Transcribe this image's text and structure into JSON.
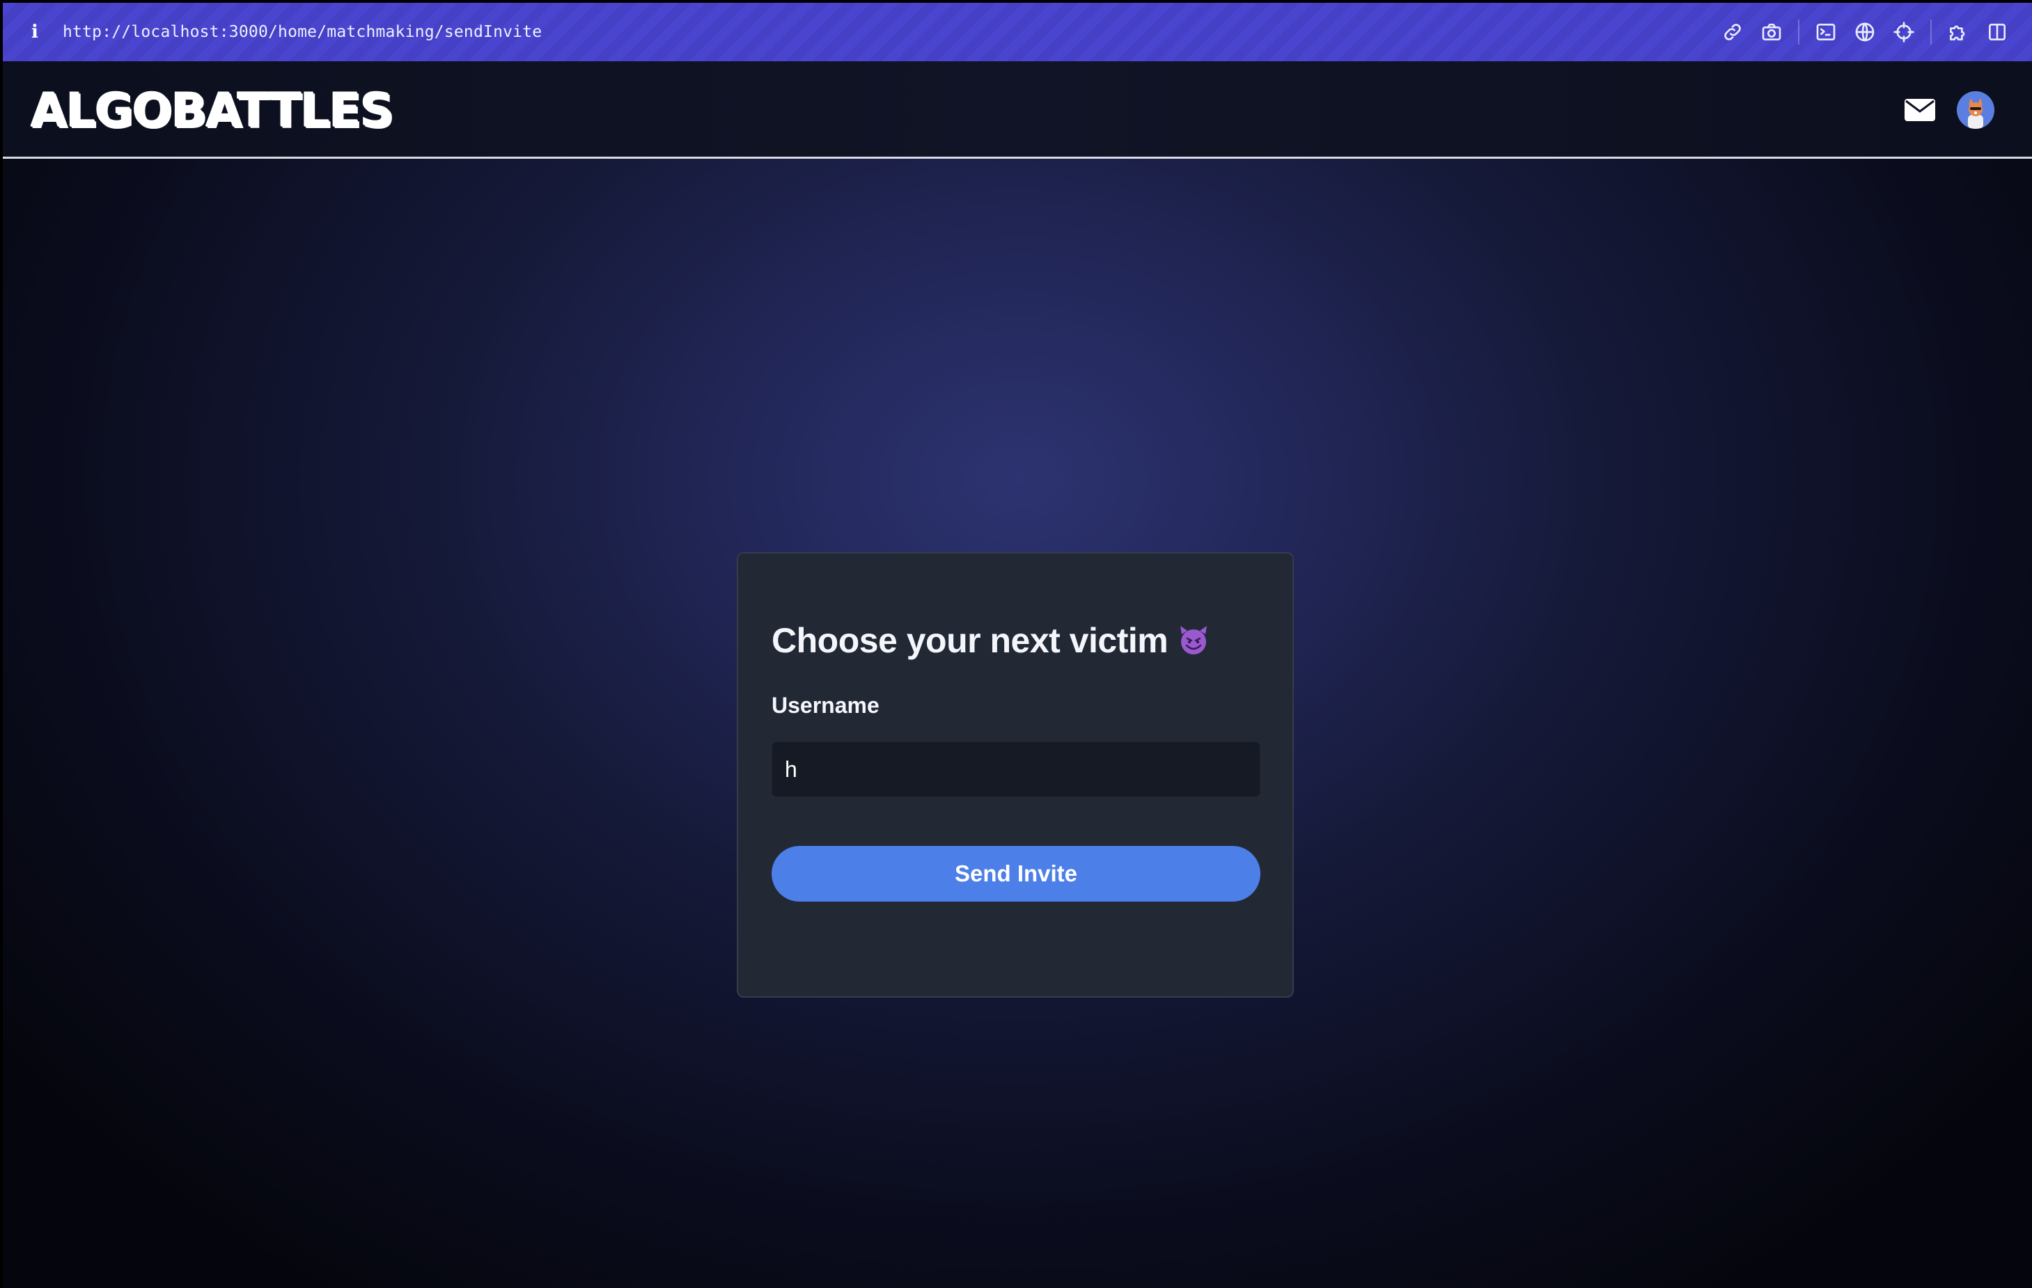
{
  "browser": {
    "info_glyph": "i",
    "url": "http://localhost:3000/home/matchmaking/sendInvite",
    "tools": [
      "link-icon",
      "camera-icon",
      "terminal-icon",
      "globe-icon",
      "crosshair-icon",
      "extensions-icon",
      "sidebar-icon"
    ]
  },
  "header": {
    "logo": "ALGOBATTLES",
    "icons": [
      "mail-icon",
      "avatar"
    ]
  },
  "card": {
    "title": "Choose your next victim",
    "title_emoji": "smiling-devil-icon",
    "username_label": "Username",
    "username_value": "h",
    "send_label": "Send Invite"
  },
  "colors": {
    "browser_bar": "#4a45cf",
    "card_bg": "#222834",
    "button": "#4c7fe8",
    "input_bg": "#151a25"
  }
}
